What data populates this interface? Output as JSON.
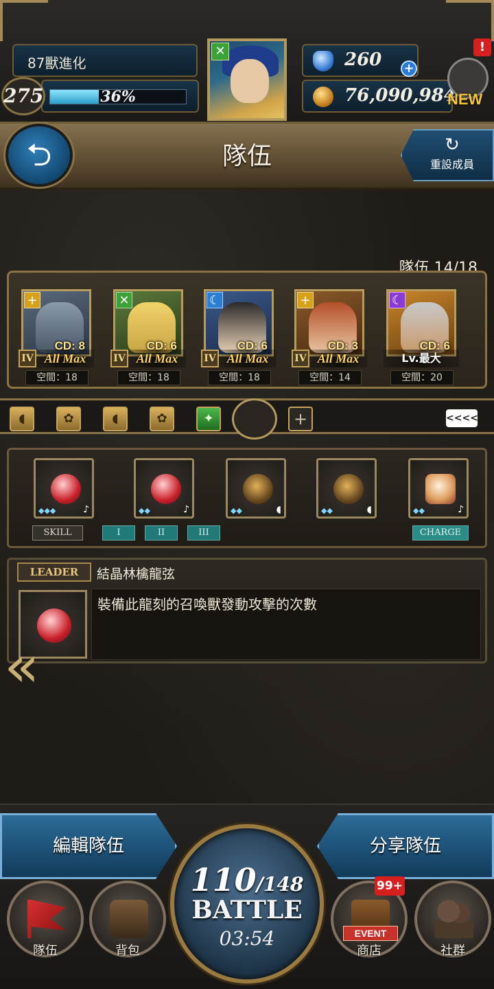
{
  "player": {
    "title": "87獸進化",
    "level": "275",
    "exp_percent": "36%",
    "exp_fraction": 0.36
  },
  "currency": {
    "gems": "260",
    "coins": "76,090,984"
  },
  "news": {
    "alert": "!",
    "label": "NEW"
  },
  "header": {
    "title": "隊伍",
    "reset_label": "重設成員",
    "reset_icon": "refresh-icon",
    "back_icon": "back-arrow-icon"
  },
  "team": {
    "count_label": "隊伍 14/18",
    "members": [
      {
        "cd": "CD: 8",
        "rank": "IV",
        "status": "All Max",
        "space": "空間：18",
        "attr_color": "#d6a21a",
        "attr_glyph": "+"
      },
      {
        "cd": "CD: 6",
        "rank": "IV",
        "status": "All Max",
        "space": "空間：18",
        "attr_color": "#3aa236",
        "attr_glyph": "✕"
      },
      {
        "cd": "CD: 6",
        "rank": "IV",
        "status": "All Max",
        "space": "空間：18",
        "attr_color": "#2a7fd4",
        "attr_glyph": "☾"
      },
      {
        "cd": "CD: 3",
        "rank": "IV",
        "status": "All Max",
        "space": "空間：14",
        "attr_color": "#d6a21a",
        "attr_glyph": "+"
      },
      {
        "cd": "CD: 6",
        "rank": "",
        "status": "Lv.最大",
        "space": "空間：20",
        "attr_color": "#8a3ad6",
        "attr_glyph": "☾"
      }
    ]
  },
  "rail": {
    "collapse_label": "<<<<"
  },
  "dragons": {
    "tags": [
      "SKILL",
      "I",
      "II",
      "III",
      "CHARGE"
    ]
  },
  "leader": {
    "tag": "LEADER",
    "name": "結晶林檎龍弦",
    "description": "裝備此龍刻的召喚獸發動攻擊的次數"
  },
  "bottom": {
    "edit_team": "編輯隊伍",
    "share_team": "分享隊伍",
    "stamina_current": "110",
    "stamina_max": "/148",
    "battle": "BATTLE",
    "timer": "03:54",
    "nav": [
      "隊伍",
      "背包",
      "商店",
      "社群"
    ],
    "event_badge": "99+",
    "event_ribbon": "EVENT"
  }
}
